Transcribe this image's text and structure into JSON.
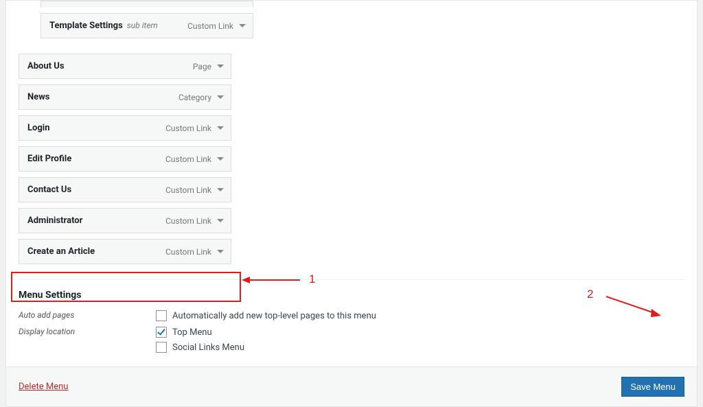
{
  "menu_items": [
    {
      "title": "Template Settings",
      "type": "Custom Link",
      "sub": true,
      "partial_top": true,
      "sub_label": "sub item"
    },
    {
      "title": "About Us",
      "type": "Page"
    },
    {
      "title": "News",
      "type": "Category"
    },
    {
      "title": "Login",
      "type": "Custom Link"
    },
    {
      "title": "Edit Profile",
      "type": "Custom Link"
    },
    {
      "title": "Contact Us",
      "type": "Custom Link"
    },
    {
      "title": "Administrator",
      "type": "Custom Link"
    },
    {
      "title": "Create an Article",
      "type": "Custom Link"
    }
  ],
  "settings": {
    "heading": "Menu Settings",
    "auto_add_label": "Auto add pages",
    "auto_add_option": "Automatically add new top-level pages to this menu",
    "auto_add_checked": false,
    "display_location_label": "Display location",
    "loc_top": "Top Menu",
    "loc_top_checked": true,
    "loc_social": "Social Links Menu",
    "loc_social_checked": false
  },
  "footer": {
    "delete": "Delete Menu",
    "save": "Save Menu"
  },
  "annotations": {
    "num1": "1",
    "num2": "2"
  }
}
